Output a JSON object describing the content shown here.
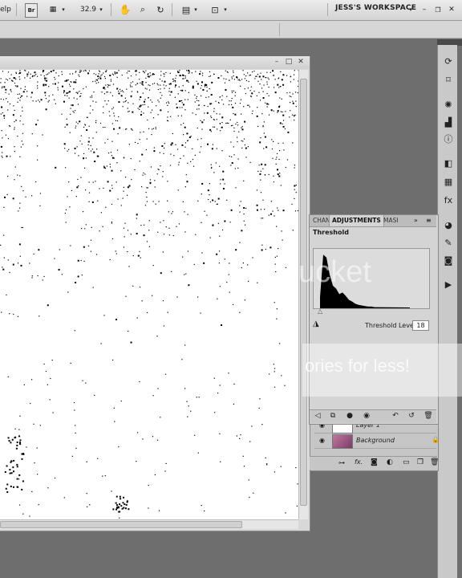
{
  "menu": {
    "help_partial": "elp",
    "bridge_label": "Br",
    "zoom": "32.9",
    "workspace": "JESS'S WORKSPACE"
  },
  "adjustments": {
    "tabs": [
      "CHAN",
      "ADJUSTMENTS",
      "MASI"
    ],
    "title": "Threshold",
    "threshold_label": "Threshold Level:",
    "threshold_value": "18"
  },
  "layers": [
    {
      "name": "Layer 1",
      "visible": true
    },
    {
      "name": "Background",
      "visible": true,
      "locked": true
    }
  ],
  "colors": {
    "accent": "#3d9bff",
    "dock": "#c9c9c9",
    "panel": "#d4d4d4",
    "workspace_bg": "#6e6e6e"
  },
  "histogram": {
    "peak_fraction": 0.95,
    "threshold_level": 18
  },
  "watermark": {
    "logo": "ucket",
    "text": "ories for less!"
  }
}
